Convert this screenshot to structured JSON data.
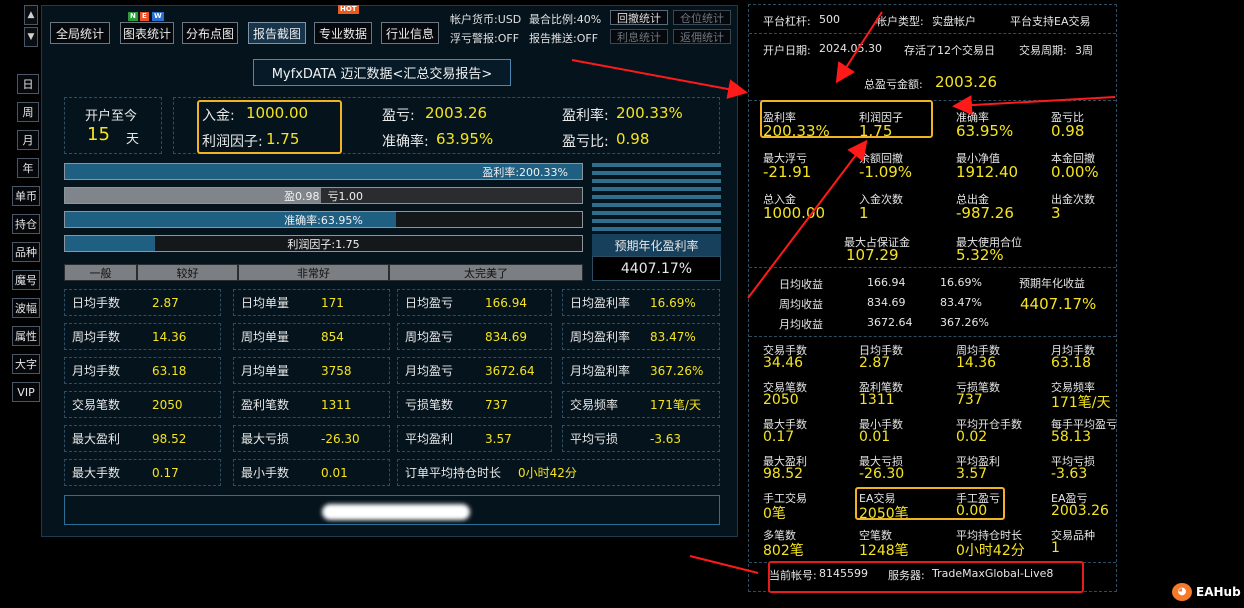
{
  "nav": {
    "scroll_up": "▲",
    "scroll_down": "▼",
    "periods": [
      "日",
      "周",
      "月",
      "年"
    ],
    "tools": [
      "单币",
      "持仓",
      "品种",
      "魔号",
      "波幅",
      "属性",
      "大字",
      "VIP"
    ]
  },
  "toolbar": {
    "buttons": [
      "全局统计",
      "图表统计",
      "分布点图",
      "报告截图",
      "专业数据",
      "行业信息"
    ],
    "new_badge": [
      "N",
      "E",
      "W"
    ],
    "hot_badge": "HOT",
    "account_currency": "帐户货币:USD",
    "max_ratio": "最合比例:40%",
    "float_alert": "浮亏警报:OFF",
    "report_push": "报告推送:OFF",
    "btn_drawdown": "回撤统计",
    "btn_position": "仓位统计",
    "btn_interest": "利息统计",
    "btn_rebate": "返佣统计"
  },
  "report_title": "MyfxDATA 迈汇数据<汇总交易报告>",
  "summary": {
    "open_since_label": "开户至今",
    "open_days": "15",
    "days_unit": "天",
    "deposit_label": "入金:",
    "deposit_value": "1000.00",
    "profit_factor_label": "利润因子:",
    "profit_factor_value": "1.75",
    "pnl_label": "盈亏:",
    "pnl_value": "2003.26",
    "win_rate_label": "准确率:",
    "win_rate_value": "63.95%",
    "profit_rate_label": "盈利率:",
    "profit_rate_value": "200.33%",
    "pl_ratio_label": "盈亏比:",
    "pl_ratio_value": "0.98"
  },
  "bars": {
    "profit_rate": {
      "label": "盈利率:200.33%",
      "fill": 1.0
    },
    "profit_loss": {
      "profit": "盈0.98",
      "loss": "亏1.00",
      "fill": 0.495
    },
    "win_rate": {
      "label": "准确率:63.95%",
      "fill": 0.6395
    },
    "profit_factor": {
      "label": "利润因子:1.75",
      "fill": 0.175
    }
  },
  "scale": [
    "一般",
    "较好",
    "非常好",
    "太完美了"
  ],
  "annual": {
    "label": "预期年化盈利率",
    "value": "4407.17%"
  },
  "stats": [
    [
      "日均手数",
      "2.87",
      "日均单量",
      "171",
      "日均盈亏",
      "166.94",
      "日均盈利率",
      "16.69%"
    ],
    [
      "周均手数",
      "14.36",
      "周均单量",
      "854",
      "周均盈亏",
      "834.69",
      "周均盈利率",
      "83.47%"
    ],
    [
      "月均手数",
      "63.18",
      "月均单量",
      "3758",
      "月均盈亏",
      "3672.64",
      "月均盈利率",
      "367.26%"
    ],
    [
      "交易笔数",
      "2050",
      "盈利笔数",
      "1311",
      "亏损笔数",
      "737",
      "交易频率",
      "171笔/天"
    ],
    [
      "最大盈利",
      "98.52",
      "最大亏损",
      "-26.30",
      "平均盈利",
      "3.57",
      "平均亏损",
      "-3.63"
    ]
  ],
  "last_row": {
    "max_lots_label": "最大手数",
    "max_lots": "0.17",
    "min_lots_label": "最小手数",
    "min_lots": "0.01",
    "avg_hold_label": "订单平均持仓时长",
    "avg_hold": "0小时42分"
  },
  "right": {
    "leverage_label": "平台杠杆:",
    "leverage": "500",
    "account_type_label": "帐户类型:",
    "account_type": "实盘帐户",
    "ea_support": "平台支持EA交易",
    "open_date_label": "开户日期:",
    "open_date": "2024.05.30",
    "trade_days": "存活了12个交易日",
    "trade_period_label": "交易周期:",
    "trade_period": "3周",
    "total_pnl_label": "总盈亏金额:",
    "total_pnl": "2003.26",
    "grid1": [
      [
        "盈利率",
        "200.33%",
        "利润因子",
        "1.75",
        "准确率",
        "63.95%",
        "盈亏比",
        "0.98"
      ],
      [
        "最大浮亏",
        "-21.91",
        "余额回撤",
        "-1.09%",
        "最小净值",
        "1912.40",
        "本金回撤",
        "0.00%"
      ],
      [
        "总入金",
        "1000.00",
        "入金次数",
        "1",
        "总出金",
        "-987.26",
        "出金次数",
        "3"
      ]
    ],
    "max_margin_label": "最大占保证金",
    "max_margin": "107.29",
    "max_position_label": "最大使用合位",
    "max_position": "5.32%",
    "earn_rows": [
      [
        "日均收益",
        "166.94",
        "16.69%"
      ],
      [
        "周均收益",
        "834.69",
        "83.47%"
      ],
      [
        "月均收益",
        "3672.64",
        "367.26%"
      ]
    ],
    "annual_label": "预期年化收益",
    "annual_value": "4407.17%",
    "grid2": [
      [
        "交易手数",
        "34.46",
        "日均手数",
        "2.87",
        "周均手数",
        "14.36",
        "月均手数",
        "63.18"
      ],
      [
        "交易笔数",
        "2050",
        "盈利笔数",
        "1311",
        "亏损笔数",
        "737",
        "交易频率",
        "171笔/天"
      ],
      [
        "最大手数",
        "0.17",
        "最小手数",
        "0.01",
        "平均开仓手数",
        "0.02",
        "每手平均盈亏",
        "58.13"
      ],
      [
        "最大盈利",
        "98.52",
        "最大亏损",
        "-26.30",
        "平均盈利",
        "3.57",
        "平均亏损",
        "-3.63"
      ],
      [
        "手工交易",
        "0笔",
        "EA交易",
        "2050笔",
        "手工盈亏",
        "0.00",
        "EA盈亏",
        "2003.26"
      ],
      [
        "多笔数",
        "802笔",
        "空笔数",
        "1248笔",
        "平均持仓时长",
        "0小时42分",
        "交易品种",
        "1"
      ]
    ],
    "account_label": "当前帐号:",
    "account": "8145599",
    "server_label": "服务器:",
    "server": "TradeMaxGlobal-Live8"
  },
  "watermark": "EAHub",
  "colors": {
    "accent": "#f5e41f",
    "highlight": "#f0b423",
    "arrow": "#ff1a1a",
    "bar": "#1f5f82"
  }
}
